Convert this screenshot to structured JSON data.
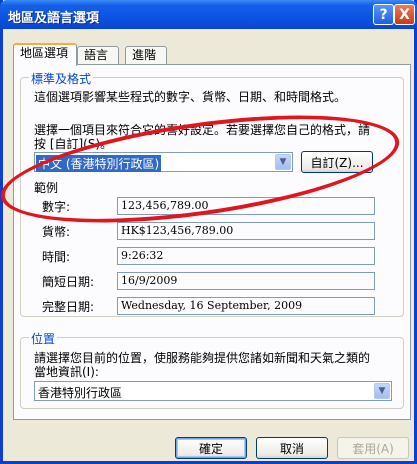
{
  "window": {
    "title": "地區及語言選項",
    "help_label": "?",
    "close_label": "X"
  },
  "tabs": [
    {
      "label": "地區選項",
      "active": true
    },
    {
      "label": "語言",
      "active": false
    },
    {
      "label": "進階",
      "active": false
    }
  ],
  "standards": {
    "group_title": "標準及格式",
    "description": "這個選項影響某些程式的數字、貨幣、日期、和時間格式。",
    "instruction_line1": "選擇一個項目來符合它的喜好設定。若要選擇您自己的格式，請",
    "instruction_line2": "按 [自訂](S)。",
    "selected_locale": "中文 (香港特別行政區)",
    "customize_button": "自訂(Z)..."
  },
  "samples": {
    "heading": "範例",
    "rows": [
      {
        "label": "數字:",
        "value": "123,456,789.00"
      },
      {
        "label": "貨幣:",
        "value": "HK$123,456,789.00"
      },
      {
        "label": "時間:",
        "value": "9:26:32"
      },
      {
        "label": "簡短日期:",
        "value": "16/9/2009"
      },
      {
        "label": "完整日期:",
        "value": "Wednesday, 16 September, 2009"
      }
    ]
  },
  "location": {
    "group_title": "位置",
    "description_line1": "請選擇您目前的位置，使服務能夠提供您諸如新聞和天氣之類的",
    "description_line2": "當地資訊(I):",
    "selected_location": "香港特別行政區"
  },
  "footer": {
    "ok_button": "確定",
    "cancel_button": "取消",
    "apply_button": "套用(A)"
  },
  "annotation_color": "#e0151e"
}
